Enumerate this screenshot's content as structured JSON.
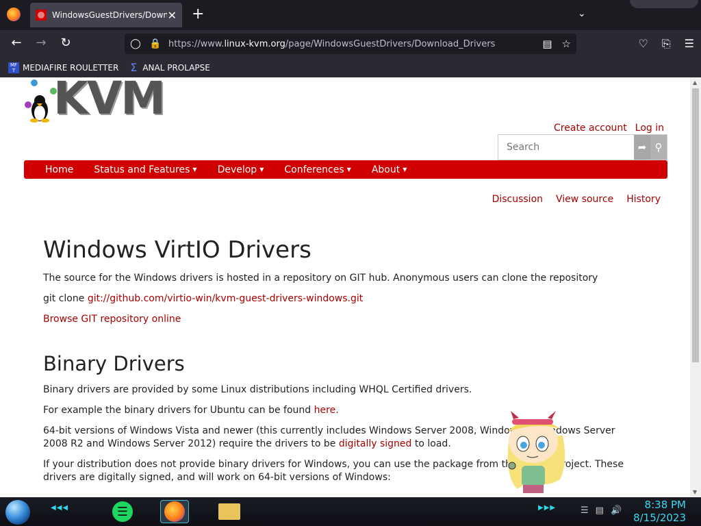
{
  "browser": {
    "tab_title": "WindowsGuestDrivers/Download_Drivers",
    "tab_close": "✕",
    "new_tab": "+",
    "url_prefix": "https://www.",
    "url_domain": "linux-kvm.org",
    "url_path": "/page/WindowsGuestDrivers/Download_Drivers",
    "bookmarks": [
      {
        "label": "MEDIAFIRE ROULETTER",
        "icon": "mediafire-icon"
      },
      {
        "label": "ANAL PROLAPSE",
        "icon": "sigma-icon"
      }
    ]
  },
  "site": {
    "logo_text": "KVM",
    "create_account": "Create account",
    "log_in": "Log in",
    "search_placeholder": "Search",
    "menu": [
      "Home",
      "Status and Features",
      "Develop",
      "Conferences",
      "About"
    ],
    "page_actions": [
      "Discussion",
      "View source",
      "History"
    ]
  },
  "content": {
    "h1": "Windows VirtIO Drivers",
    "p1": "The source for the Windows drivers is hosted in a repository on GIT hub. Anonymous users can clone the repository",
    "git_clone_prefix": "git clone ",
    "git_clone_link": "git://github.com/virtio-win/kvm-guest-drivers-windows.git",
    "browse_link": "Browse GIT repository online",
    "h2": "Binary Drivers",
    "p2": "Binary drivers are provided by some Linux distributions including WHQL Certified drivers.",
    "p3_prefix": "For example the binary drivers for Ubuntu can be found ",
    "p3_link": "here",
    "p3_suffix": ".",
    "p4_prefix": "64-bit versions of Windows Vista and newer (this currently includes Windows Server 2008, Windows 7, Windows Server 2008 R2 and Windows Server 2012) require the drivers to be ",
    "p4_link": "digitally signed",
    "p4_suffix": " to load.",
    "p5": "If your distribution does not provide binary drivers for Windows, you can use the package from the Fedora Project. These drivers are digitally signed, and will work on 64-bit versions of Windows:"
  },
  "taskbar": {
    "time": "8:38 PM",
    "date": "8/15/2023"
  },
  "colors": {
    "accent_red": "#d00000",
    "link_red": "#a60000",
    "clock_cyan": "#3ed7ee"
  }
}
